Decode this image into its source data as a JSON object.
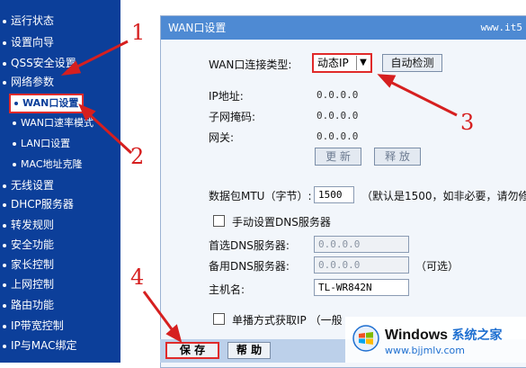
{
  "sidebar": {
    "items": [
      {
        "label": "运行状态",
        "type": "main"
      },
      {
        "label": "设置向导",
        "type": "main"
      },
      {
        "label": "QSS安全设置",
        "type": "main"
      },
      {
        "label": "网络参数",
        "type": "main"
      },
      {
        "label": "WAN口设置",
        "type": "sub",
        "active": true
      },
      {
        "label": "WAN口速率模式",
        "type": "sub"
      },
      {
        "label": "LAN口设置",
        "type": "sub"
      },
      {
        "label": "MAC地址克隆",
        "type": "sub"
      },
      {
        "label": "无线设置",
        "type": "main"
      },
      {
        "label": "DHCP服务器",
        "type": "main"
      },
      {
        "label": "转发规则",
        "type": "main"
      },
      {
        "label": "安全功能",
        "type": "main"
      },
      {
        "label": "家长控制",
        "type": "main"
      },
      {
        "label": "上网控制",
        "type": "main"
      },
      {
        "label": "路由功能",
        "type": "main"
      },
      {
        "label": "IP带宽控制",
        "type": "main"
      },
      {
        "label": "IP与MAC绑定",
        "type": "main"
      }
    ]
  },
  "panel": {
    "title": "WAN口设置",
    "url": "www.it5"
  },
  "form": {
    "conn_type_label": "WAN口连接类型:",
    "conn_type_value": "动态IP",
    "auto_detect": "自动检测",
    "ip_label": "IP地址:",
    "ip_value": "0.0.0.0",
    "mask_label": "子网掩码:",
    "mask_value": "0.0.0.0",
    "gw_label": "网关:",
    "gw_value": "0.0.0.0",
    "renew": "更 新",
    "release": "释 放",
    "mtu_label": "数据包MTU（字节）:",
    "mtu_value": "1500",
    "mtu_hint": "（默认是1500，如非必要，请勿修",
    "manual_dns": "手动设置DNS服务器",
    "dns1_label": "首选DNS服务器:",
    "dns1_value": "0.0.0.0",
    "dns2_label": "备用DNS服务器:",
    "dns2_value": "0.0.0.0",
    "optional": "（可选）",
    "host_label": "主机名:",
    "host_value": "TL-WR842N",
    "unicast": "单播方式获取IP （一般",
    "save": "保 存",
    "help": "帮 助"
  },
  "annotations": [
    "1",
    "2",
    "3",
    "4"
  ],
  "watermark": {
    "title": "Windows",
    "subtitle": "系统之家",
    "url": "www.bjjmlv.com"
  },
  "colors": {
    "sidebar": "#0c3f9a",
    "header": "#4e8ad3",
    "highlight": "#e02a2a"
  }
}
